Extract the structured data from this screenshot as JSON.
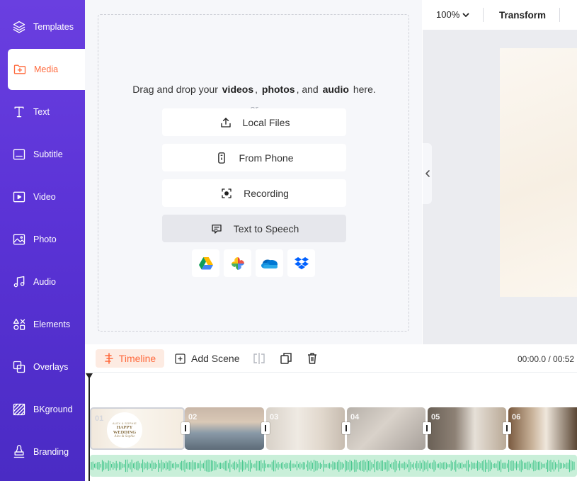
{
  "sidebar": {
    "items": [
      {
        "label": "Templates",
        "icon": "layers-icon"
      },
      {
        "label": "Media",
        "icon": "media-folder-icon",
        "active": true
      },
      {
        "label": "Text",
        "icon": "text-icon"
      },
      {
        "label": "Subtitle",
        "icon": "subtitle-icon"
      },
      {
        "label": "Video",
        "icon": "video-icon"
      },
      {
        "label": "Photo",
        "icon": "photo-icon"
      },
      {
        "label": "Audio",
        "icon": "music-icon"
      },
      {
        "label": "Elements",
        "icon": "shapes-icon"
      },
      {
        "label": "Overlays",
        "icon": "overlay-icon"
      },
      {
        "label": "BKground",
        "icon": "background-icon"
      },
      {
        "label": "Branding",
        "icon": "stamp-icon"
      }
    ],
    "accent_color": "#ff6a3d",
    "bg_color": "#5b33d6"
  },
  "media": {
    "drop_prefix": "Drag and drop your",
    "drop_videos": "videos",
    "drop_comma1": ",",
    "drop_photos": "photos",
    "drop_and": ", and",
    "drop_audio": "audio",
    "drop_suffix": "here.",
    "or": "or",
    "buttons": [
      {
        "label": "Local Files",
        "icon": "upload-icon"
      },
      {
        "label": "From Phone",
        "icon": "phone-icon"
      },
      {
        "label": "Recording",
        "icon": "record-icon"
      },
      {
        "label": "Text to Speech",
        "icon": "speech-bubble-icon"
      }
    ],
    "cloud_sources": [
      "google-drive-icon",
      "google-photos-icon",
      "onedrive-icon",
      "dropbox-icon"
    ]
  },
  "toolbar": {
    "zoom": "100%",
    "transform_label": "Transform"
  },
  "timeline": {
    "tab_label": "Timeline",
    "add_scene_label": "Add Scene",
    "time": "00:00.0 / 00:52",
    "clips": [
      {
        "num": "01"
      },
      {
        "num": "02"
      },
      {
        "num": "03"
      },
      {
        "num": "04"
      },
      {
        "num": "05"
      },
      {
        "num": "06"
      }
    ],
    "first_clip_card": {
      "small_top": "ALEX & SOPHIE",
      "title_line1": "HAPPY",
      "title_line2": "WEDDING",
      "signature": "Alex & Sophie"
    }
  }
}
